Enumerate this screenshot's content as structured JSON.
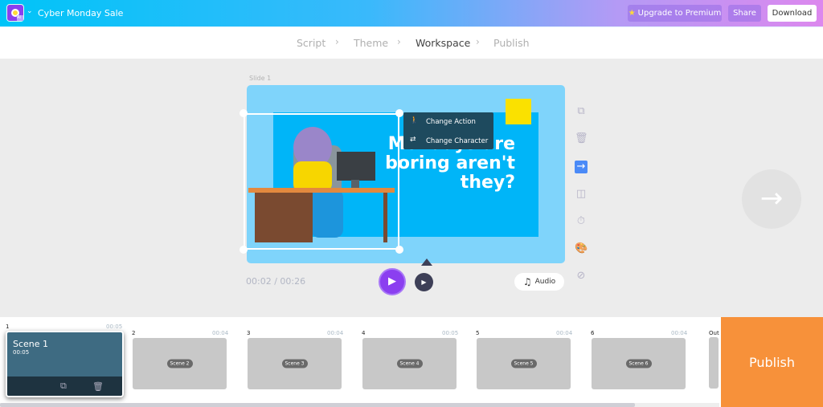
{
  "header": {
    "project_title": "Cyber Monday Sale",
    "logo_badge": "AI",
    "upgrade_label": "Upgrade to Premium",
    "share_label": "Share",
    "download_label": "Download"
  },
  "steps": [
    {
      "label": "Script"
    },
    {
      "label": "Theme"
    },
    {
      "label": "Workspace",
      "active": true
    },
    {
      "label": "Publish"
    }
  ],
  "slide": {
    "label": "Slide 1",
    "headline_lines": [
      "Mondays are",
      "boring aren't",
      "they?"
    ],
    "context_menu": [
      {
        "icon": "walk-icon",
        "label": "Change Action"
      },
      {
        "icon": "swap-character-icon",
        "label": "Change Character"
      }
    ]
  },
  "player": {
    "time": "00:02 / 00:26",
    "audio_label": "Audio"
  },
  "tools": [
    "duplicate-icon",
    "trash-icon",
    "transition-arrow-icon",
    "layout-icon",
    "timer-icon",
    "palette-icon",
    "hide-icon"
  ],
  "timeline": {
    "scenes": [
      {
        "num": "1",
        "duration": "00:05",
        "title": "Scene 1",
        "active": true
      },
      {
        "num": "2",
        "duration": "00:04",
        "title": "Scene 2"
      },
      {
        "num": "3",
        "duration": "00:04",
        "title": "Scene 3"
      },
      {
        "num": "4",
        "duration": "00:05",
        "title": "Scene 4"
      },
      {
        "num": "5",
        "duration": "00:04",
        "title": "Scene 5"
      },
      {
        "num": "6",
        "duration": "00:04",
        "title": "Scene 6"
      }
    ],
    "outro_label": "Out"
  },
  "publish_label": "Publish",
  "colors": {
    "accent_purple": "#8b3ff0",
    "publish_orange": "#f7913a",
    "slide_bg": "#7fd4fb",
    "active_tool": "#4a8af7"
  }
}
